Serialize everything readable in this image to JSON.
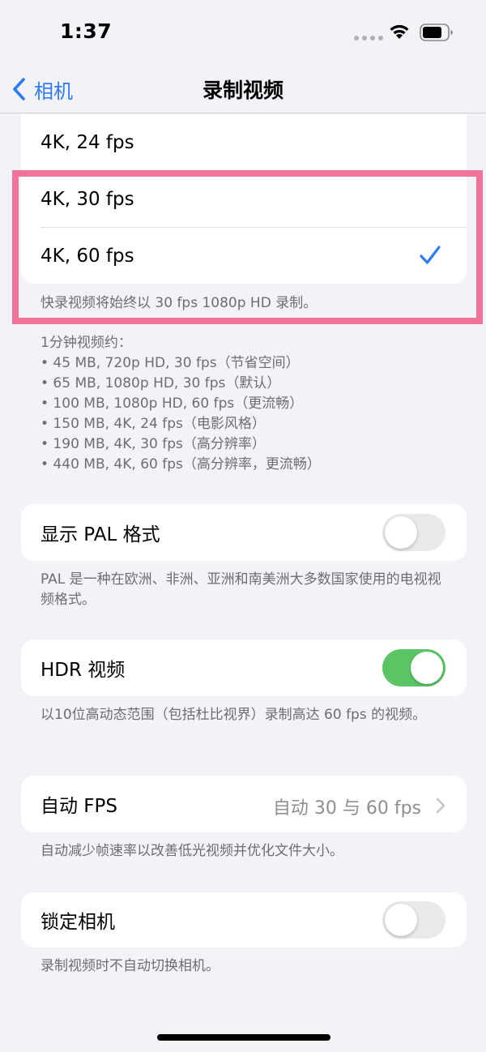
{
  "status": {
    "time": "1:37"
  },
  "nav": {
    "back_label": "相机",
    "title": "录制视频"
  },
  "formats": [
    {
      "label": "4K, 24 fps",
      "selected": false
    },
    {
      "label": "4K, 30 fps",
      "selected": false
    },
    {
      "label": "4K, 60 fps",
      "selected": true
    }
  ],
  "formats_footnote": "快录视频将始终以 30 fps 1080p HD 录制。",
  "size_info": {
    "heading": "1分钟视频约：",
    "items": [
      "• 45 MB, 720p HD, 30 fps（节省空间）",
      "• 65 MB, 1080p HD, 30 fps（默认）",
      "• 100 MB, 1080p HD, 60 fps（更流畅）",
      "• 150 MB, 4K, 24 fps（电影风格）",
      "• 190 MB, 4K, 30 fps（高分辨率）",
      "• 440 MB, 4K, 60 fps（高分辨率，更流畅）"
    ]
  },
  "pal": {
    "label": "显示 PAL 格式",
    "on": false,
    "footnote": "PAL 是一种在欧洲、非洲、亚洲和南美洲大多数国家使用的电视视频格式。"
  },
  "hdr": {
    "label": "HDR 视频",
    "on": true,
    "footnote": "以10位高动态范围（包括杜比视界）录制高达 60 fps 的视频。"
  },
  "auto_fps": {
    "label": "自动 FPS",
    "value": "自动 30 与 60 fps",
    "footnote": "自动减少帧速率以改善低光视频并优化文件大小。"
  },
  "lock_camera": {
    "label": "锁定相机",
    "on": false,
    "footnote": "录制视频时不自动切换相机。"
  },
  "colors": {
    "accent": "#2F7CF6",
    "toggle_on": "#5BC566",
    "highlight": "#F0739A"
  }
}
